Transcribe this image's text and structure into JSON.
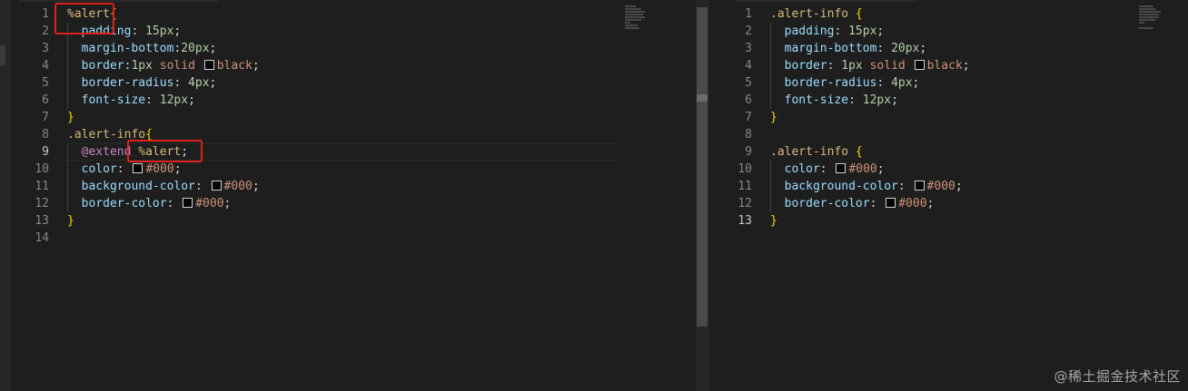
{
  "left_editor": {
    "lines": [
      {
        "n": "1",
        "parts": [
          [
            "sel",
            "%alert"
          ],
          [
            "brace",
            "{"
          ]
        ]
      },
      {
        "n": "2",
        "parts": [
          [
            "prop",
            "  padding"
          ],
          [
            "punc",
            ": "
          ],
          [
            "num",
            "15px"
          ],
          [
            "punc",
            ";"
          ]
        ]
      },
      {
        "n": "3",
        "parts": [
          [
            "prop",
            "  margin-bottom"
          ],
          [
            "punc",
            ":"
          ],
          [
            "num",
            "20px"
          ],
          [
            "punc",
            ";"
          ]
        ]
      },
      {
        "n": "4",
        "parts": [
          [
            "prop",
            "  border"
          ],
          [
            "punc",
            ":"
          ],
          [
            "num",
            "1px"
          ],
          [
            "val",
            " solid "
          ],
          [
            "swatch",
            ""
          ],
          [
            "val",
            "black"
          ],
          [
            "punc",
            ";"
          ]
        ]
      },
      {
        "n": "5",
        "parts": [
          [
            "prop",
            "  border-radius"
          ],
          [
            "punc",
            ": "
          ],
          [
            "num",
            "4px"
          ],
          [
            "punc",
            ";"
          ]
        ]
      },
      {
        "n": "6",
        "parts": [
          [
            "prop",
            "  font-size"
          ],
          [
            "punc",
            ": "
          ],
          [
            "num",
            "12px"
          ],
          [
            "punc",
            ";"
          ]
        ]
      },
      {
        "n": "7",
        "parts": [
          [
            "brace",
            "}"
          ]
        ]
      },
      {
        "n": "8",
        "parts": [
          [
            "sel",
            ".alert-info"
          ],
          [
            "brace",
            "{"
          ]
        ]
      },
      {
        "n": "9",
        "parts": [
          [
            "at",
            "  @extend"
          ],
          [
            "punc",
            " "
          ],
          [
            "sel",
            "%alert"
          ],
          [
            "punc",
            ";"
          ]
        ]
      },
      {
        "n": "10",
        "parts": [
          [
            "prop",
            "  color"
          ],
          [
            "punc",
            ": "
          ],
          [
            "swatch",
            ""
          ],
          [
            "val",
            "#000"
          ],
          [
            "punc",
            ";"
          ]
        ]
      },
      {
        "n": "11",
        "parts": [
          [
            "prop",
            "  background-color"
          ],
          [
            "punc",
            ": "
          ],
          [
            "swatch",
            ""
          ],
          [
            "val",
            "#000"
          ],
          [
            "punc",
            ";"
          ]
        ]
      },
      {
        "n": "12",
        "parts": [
          [
            "prop",
            "  border-color"
          ],
          [
            "punc",
            ": "
          ],
          [
            "swatch",
            ""
          ],
          [
            "val",
            "#000"
          ],
          [
            "punc",
            ";"
          ]
        ]
      },
      {
        "n": "13",
        "parts": [
          [
            "brace",
            "}"
          ]
        ]
      },
      {
        "n": "14",
        "parts": []
      }
    ]
  },
  "right_editor": {
    "lines": [
      {
        "n": "1",
        "parts": [
          [
            "sel",
            ".alert-info"
          ],
          [
            "punc",
            " "
          ],
          [
            "brace",
            "{"
          ]
        ]
      },
      {
        "n": "2",
        "parts": [
          [
            "prop",
            "  padding"
          ],
          [
            "punc",
            ": "
          ],
          [
            "num",
            "15px"
          ],
          [
            "punc",
            ";"
          ]
        ]
      },
      {
        "n": "3",
        "parts": [
          [
            "prop",
            "  margin-bottom"
          ],
          [
            "punc",
            ": "
          ],
          [
            "num",
            "20px"
          ],
          [
            "punc",
            ";"
          ]
        ]
      },
      {
        "n": "4",
        "parts": [
          [
            "prop",
            "  border"
          ],
          [
            "punc",
            ": "
          ],
          [
            "num",
            "1px"
          ],
          [
            "val",
            " solid "
          ],
          [
            "swatch",
            ""
          ],
          [
            "val",
            "black"
          ],
          [
            "punc",
            ";"
          ]
        ]
      },
      {
        "n": "5",
        "parts": [
          [
            "prop",
            "  border-radius"
          ],
          [
            "punc",
            ": "
          ],
          [
            "num",
            "4px"
          ],
          [
            "punc",
            ";"
          ]
        ]
      },
      {
        "n": "6",
        "parts": [
          [
            "prop",
            "  font-size"
          ],
          [
            "punc",
            ": "
          ],
          [
            "num",
            "12px"
          ],
          [
            "punc",
            ";"
          ]
        ]
      },
      {
        "n": "7",
        "parts": [
          [
            "brace",
            "}"
          ]
        ]
      },
      {
        "n": "8",
        "parts": []
      },
      {
        "n": "9",
        "parts": [
          [
            "sel",
            ".alert-info"
          ],
          [
            "punc",
            " "
          ],
          [
            "brace",
            "{"
          ]
        ]
      },
      {
        "n": "10",
        "parts": [
          [
            "prop",
            "  color"
          ],
          [
            "punc",
            ": "
          ],
          [
            "swatch",
            ""
          ],
          [
            "val",
            "#000"
          ],
          [
            "punc",
            ";"
          ]
        ]
      },
      {
        "n": "11",
        "parts": [
          [
            "prop",
            "  background-color"
          ],
          [
            "punc",
            ": "
          ],
          [
            "swatch",
            ""
          ],
          [
            "val",
            "#000"
          ],
          [
            "punc",
            ";"
          ]
        ]
      },
      {
        "n": "12",
        "parts": [
          [
            "prop",
            "  border-color"
          ],
          [
            "punc",
            ": "
          ],
          [
            "swatch",
            ""
          ],
          [
            "val",
            "#000"
          ],
          [
            "punc",
            ";"
          ]
        ]
      },
      {
        "n": "13",
        "parts": [
          [
            "brace",
            "}"
          ]
        ]
      }
    ]
  },
  "watermark": "@稀土掘金技术社区",
  "colors": {
    "background": "#1e1e1e",
    "selector": "#d7ba7d",
    "property": "#9cdcfe",
    "string_value": "#ce9178",
    "number": "#b5cea8",
    "at_rule": "#c586c0",
    "bracket": "#ffd700",
    "highlight_box": "#e0211b"
  }
}
